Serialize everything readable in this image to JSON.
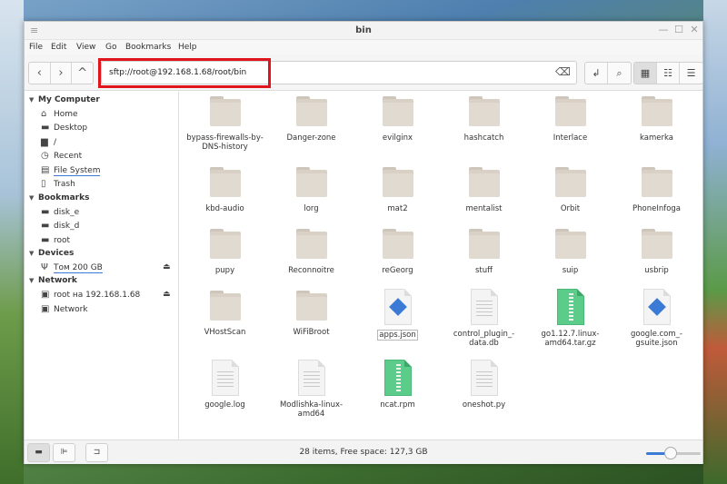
{
  "window": {
    "title": "bin",
    "menu_icon": "≡",
    "minimize": "—",
    "maximize": "☐",
    "close": "✕"
  },
  "menubar": [
    "File",
    "Edit",
    "View",
    "Go",
    "Bookmarks",
    "Help"
  ],
  "toolbar": {
    "back_icon": "‹",
    "forward_icon": "›",
    "up_icon": "^",
    "path": "sftp://root@192.168.1.68/root/bin",
    "clear_icon": "⌫",
    "open_terminal_icon": "↲",
    "search_icon": "⌕",
    "view_icons_icon": "▦",
    "view_compact_icon": "☷",
    "view_list_icon": "☰",
    "active_view": "icons"
  },
  "sidebar": {
    "sections": [
      {
        "label": "My Computer",
        "items": [
          {
            "label": "Home",
            "icon": "home-icon",
            "glyph": "⌂"
          },
          {
            "label": "Desktop",
            "icon": "desktop-icon",
            "glyph": "▬"
          },
          {
            "label": "/",
            "icon": "drive-icon",
            "glyph": "▆"
          },
          {
            "label": "Recent",
            "icon": "recent-icon",
            "glyph": "◷"
          },
          {
            "label": "File System",
            "icon": "filesystem-icon",
            "glyph": "▤",
            "active": true
          },
          {
            "label": "Trash",
            "icon": "trash-icon",
            "glyph": "▯"
          }
        ]
      },
      {
        "label": "Bookmarks",
        "items": [
          {
            "label": "disk_e",
            "icon": "folder-icon",
            "glyph": "▬"
          },
          {
            "label": "disk_d",
            "icon": "folder-icon",
            "glyph": "▬"
          },
          {
            "label": "root",
            "icon": "folder-icon",
            "glyph": "▬"
          }
        ]
      },
      {
        "label": "Devices",
        "items": [
          {
            "label": "Том 200 GB",
            "icon": "usb-icon",
            "glyph": "Ψ",
            "eject": true
          }
        ]
      },
      {
        "label": "Network",
        "items": [
          {
            "label": "root на 192.168.1.68",
            "icon": "network-share-icon",
            "glyph": "▣",
            "eject": true
          },
          {
            "label": "Network",
            "icon": "network-icon",
            "glyph": "▣"
          }
        ]
      }
    ],
    "eject_glyph": "⏏",
    "caret_glyph": "▼"
  },
  "files": [
    {
      "name": "bypass-firewalls-by-DNS-history",
      "type": "folder"
    },
    {
      "name": "Danger-zone",
      "type": "folder"
    },
    {
      "name": "evilginx",
      "type": "folder"
    },
    {
      "name": "hashcatch",
      "type": "folder"
    },
    {
      "name": "Interlace",
      "type": "folder"
    },
    {
      "name": "kamerka",
      "type": "folder"
    },
    {
      "name": "kbd-audio",
      "type": "folder"
    },
    {
      "name": "lorg",
      "type": "folder"
    },
    {
      "name": "mat2",
      "type": "folder"
    },
    {
      "name": "mentalist",
      "type": "folder"
    },
    {
      "name": "Orbit",
      "type": "folder"
    },
    {
      "name": "PhoneInfoga",
      "type": "folder"
    },
    {
      "name": "pupy",
      "type": "folder"
    },
    {
      "name": "Reconnoitre",
      "type": "folder"
    },
    {
      "name": "reGeorg",
      "type": "folder"
    },
    {
      "name": "stuff",
      "type": "folder"
    },
    {
      "name": "suip",
      "type": "folder"
    },
    {
      "name": "usbrip",
      "type": "folder"
    },
    {
      "name": "VHostScan",
      "type": "folder"
    },
    {
      "name": "WiFiBroot",
      "type": "folder"
    },
    {
      "name": "apps.json",
      "type": "json",
      "selected": true
    },
    {
      "name": "control_plugin_-data.db",
      "type": "text"
    },
    {
      "name": "go1.12.7.linux-amd64.tar.gz",
      "type": "archive"
    },
    {
      "name": "google.com_-gsuite.json",
      "type": "json"
    },
    {
      "name": "google.log",
      "type": "text"
    },
    {
      "name": "Modlishka-linux-amd64",
      "type": "text"
    },
    {
      "name": "ncat.rpm",
      "type": "archive"
    },
    {
      "name": "oneshot.py",
      "type": "text"
    }
  ],
  "statusbar": {
    "places_icon": "▬",
    "tree_icon": "⊫",
    "toggle_sidebar_icon": "⊐",
    "status": "28 items, Free space: 127,3  GB",
    "zoom_level": 0.45
  }
}
